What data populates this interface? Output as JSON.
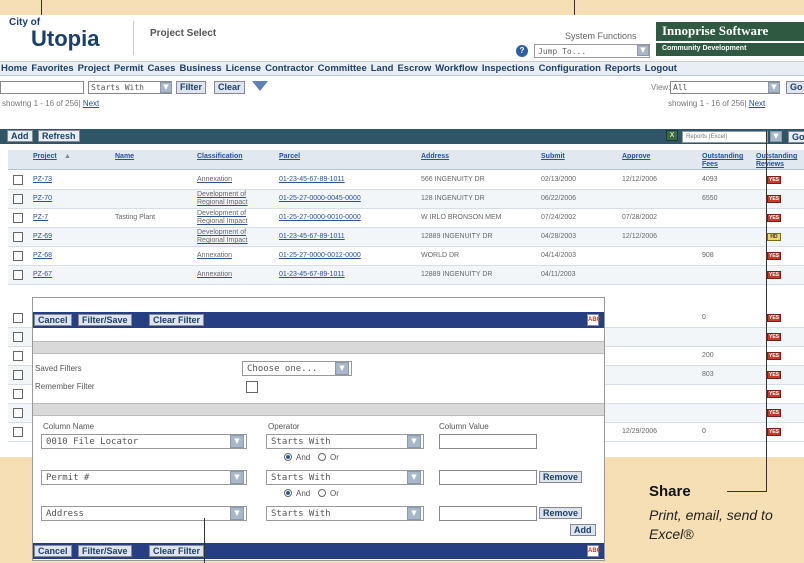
{
  "header": {
    "logo_small": "City of",
    "logo_big": "Utopia",
    "page_title": "Project Select",
    "system_functions": "System Functions",
    "help_label": "?",
    "jump_to": "Jump To...",
    "brand": "Innoprise Software",
    "brand_sub": "Community Development"
  },
  "menu": [
    "Home",
    "Favorites",
    "Project",
    "Permit",
    "Cases",
    "Business",
    "License",
    "Contractor",
    "Committee",
    "Land",
    "Escrow",
    "Workflow",
    "Inspections",
    "Configuration",
    "Reports",
    "Logout"
  ],
  "filterbar": {
    "operator": "Starts With",
    "filter_label": "Filter",
    "clear_label": "Clear",
    "view_label": "View:",
    "view_value": "All",
    "go_label": "Go",
    "showing_left": "showing 1 - 16 of 256|",
    "next_left": "Next",
    "showing_right": "showing 1 - 16 of 256|",
    "next_right": "Next"
  },
  "toolbar": {
    "add_label": "Add",
    "refresh_label": "Refresh",
    "report_select": "Reports (Excel)",
    "go_label": "Go"
  },
  "grid": {
    "columns": [
      "Project",
      "Name",
      "Classification",
      "Parcel",
      "Address",
      "Submit",
      "Approve",
      "Outstanding Fees",
      "Outstanding Reviews"
    ],
    "rows": [
      {
        "project": "PZ-73",
        "name": "",
        "class1": "Annexation",
        "class2": "",
        "parcel": "01-23-45-67-89-1011",
        "address": "566 INGENUITY DR",
        "submit": "02/13/2000",
        "approve": "12/12/2006",
        "fees": "4093",
        "review": "YES"
      },
      {
        "project": "PZ-70",
        "name": "",
        "class1": "Development of",
        "class2": "Regional Impact",
        "parcel": "01-25-27-0000-0045-0000",
        "address": "128 INGENUITY DR",
        "submit": "06/22/2006",
        "approve": "",
        "fees": "6550",
        "review": "YES"
      },
      {
        "project": "PZ-7",
        "name": "Tasting Plant",
        "class1": "Development of",
        "class2": "Regional Impact",
        "parcel": "01-25-27-0000-0010-0000",
        "address": "W IRLO BRONSON MEM",
        "submit": "07/24/2002",
        "approve": "07/28/2002",
        "fees": "",
        "review": "YES"
      },
      {
        "project": "PZ-69",
        "name": "",
        "class1": "Development of",
        "class2": "Regional Impact",
        "parcel": "01-23-45-67-89-1011",
        "address": "12889 INGENUITY DR",
        "submit": "04/28/2003",
        "approve": "12/12/2006",
        "fees": "",
        "review": "HD"
      },
      {
        "project": "PZ-68",
        "name": "",
        "class1": "Annexation",
        "class2": "",
        "parcel": "01-25-27-0000-0012-0000",
        "address": "WORLD DR",
        "submit": "04/14/2003",
        "approve": "",
        "fees": "908",
        "review": "YES"
      },
      {
        "project": "PZ-67",
        "name": "",
        "class1": "Annexation",
        "class2": "",
        "parcel": "01-23-45-67-89-1011",
        "address": "12889 INGENUITY DR",
        "submit": "04/11/2003",
        "approve": "",
        "fees": "",
        "review": "YES"
      }
    ],
    "partial_rows": [
      {
        "approve": "",
        "fees": "0",
        "review": "YES"
      },
      {
        "approve": "",
        "fees": "",
        "review": "YES"
      },
      {
        "approve": "",
        "fees": "200",
        "review": "YES"
      },
      {
        "approve": "",
        "fees": "803",
        "review": "YES"
      },
      {
        "approve": "",
        "fees": "",
        "review": "YES"
      },
      {
        "approve": "",
        "fees": "",
        "review": "YES"
      },
      {
        "approve": "12/29/2006",
        "fees": "0",
        "review": "YES"
      }
    ]
  },
  "filter_panel": {
    "cancel_label": "Cancel",
    "filter_save_label": "Filter/Save",
    "clear_filter_label": "Clear Filter",
    "spell_label": "ABC",
    "saved_filters_label": "Saved Filters",
    "saved_filters_value": "Choose one...",
    "remember_filter_label": "Remember Filter",
    "column_name_header": "Column Name",
    "operator_header": "Operator",
    "column_value_header": "Column Value",
    "and_label": "And",
    "or_label": "Or",
    "remove_label": "Remove",
    "add_label": "Add",
    "rows": [
      {
        "column": "0010 File Locator",
        "operator": "Starts With"
      },
      {
        "column": "Permit #",
        "operator": "Starts With"
      },
      {
        "column": "Address",
        "operator": "Starts With"
      }
    ]
  },
  "callout": {
    "title": "Share",
    "text": "Print, email, send to Excel®"
  }
}
